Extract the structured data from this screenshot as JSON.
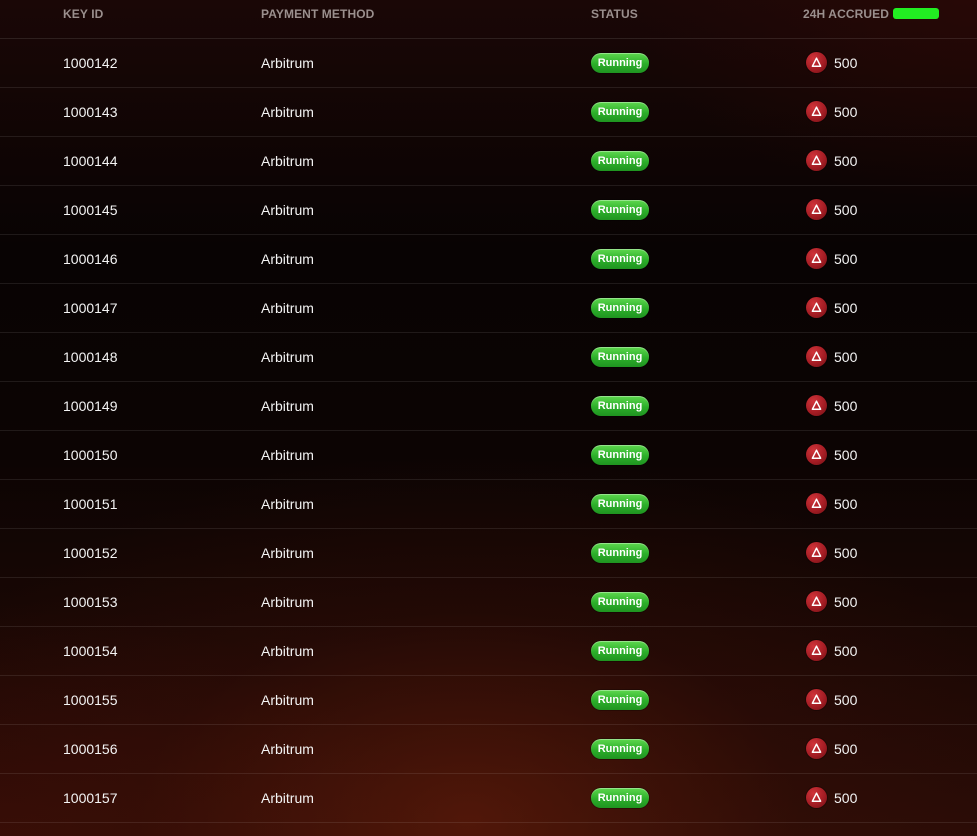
{
  "table": {
    "headers": {
      "key_id": "KEY ID",
      "payment_method": "PAYMENT METHOD",
      "status": "STATUS",
      "accrued": "24H ACCRUED"
    },
    "rows": [
      {
        "key_id": "1000142",
        "payment_method": "Arbitrum",
        "status": "Running",
        "amount": "500"
      },
      {
        "key_id": "1000143",
        "payment_method": "Arbitrum",
        "status": "Running",
        "amount": "500"
      },
      {
        "key_id": "1000144",
        "payment_method": "Arbitrum",
        "status": "Running",
        "amount": "500"
      },
      {
        "key_id": "1000145",
        "payment_method": "Arbitrum",
        "status": "Running",
        "amount": "500"
      },
      {
        "key_id": "1000146",
        "payment_method": "Arbitrum",
        "status": "Running",
        "amount": "500"
      },
      {
        "key_id": "1000147",
        "payment_method": "Arbitrum",
        "status": "Running",
        "amount": "500"
      },
      {
        "key_id": "1000148",
        "payment_method": "Arbitrum",
        "status": "Running",
        "amount": "500"
      },
      {
        "key_id": "1000149",
        "payment_method": "Arbitrum",
        "status": "Running",
        "amount": "500"
      },
      {
        "key_id": "1000150",
        "payment_method": "Arbitrum",
        "status": "Running",
        "amount": "500"
      },
      {
        "key_id": "1000151",
        "payment_method": "Arbitrum",
        "status": "Running",
        "amount": "500"
      },
      {
        "key_id": "1000152",
        "payment_method": "Arbitrum",
        "status": "Running",
        "amount": "500"
      },
      {
        "key_id": "1000153",
        "payment_method": "Arbitrum",
        "status": "Running",
        "amount": "500"
      },
      {
        "key_id": "1000154",
        "payment_method": "Arbitrum",
        "status": "Running",
        "amount": "500"
      },
      {
        "key_id": "1000155",
        "payment_method": "Arbitrum",
        "status": "Running",
        "amount": "500"
      },
      {
        "key_id": "1000156",
        "payment_method": "Arbitrum",
        "status": "Running",
        "amount": "500"
      },
      {
        "key_id": "1000157",
        "payment_method": "Arbitrum",
        "status": "Running",
        "amount": "500"
      }
    ]
  },
  "icons": {
    "token": "token-coin-icon",
    "redaction": "redaction-mark"
  },
  "colors": {
    "status_running": "#2cae2a",
    "token_coin": "#a51d24",
    "redaction": "#22ee22",
    "header_text": "#9a8f8d"
  }
}
